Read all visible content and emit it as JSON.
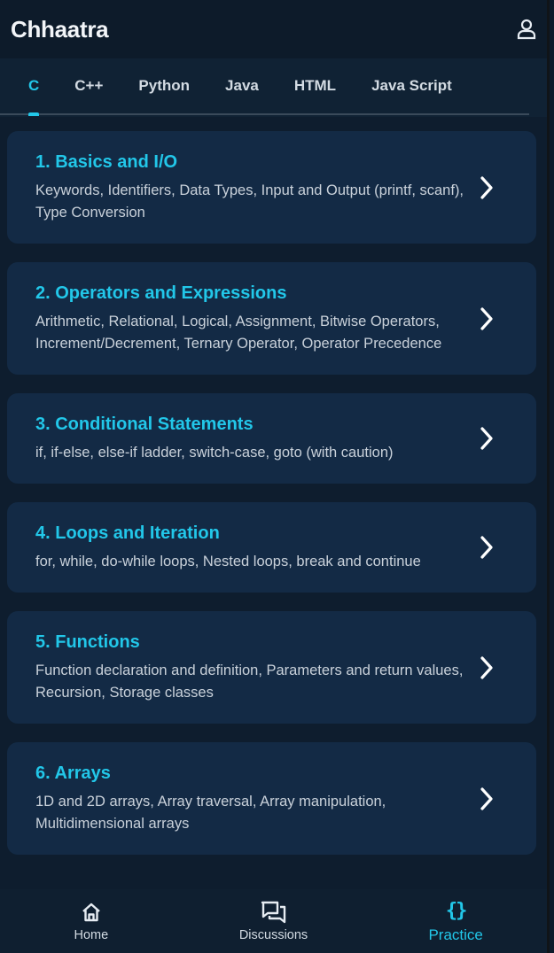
{
  "app": {
    "title": "Chhaatra"
  },
  "tabs": [
    {
      "label": "C",
      "active": true
    },
    {
      "label": "C++"
    },
    {
      "label": "Python"
    },
    {
      "label": "Java"
    },
    {
      "label": "HTML"
    },
    {
      "label": "Java Script"
    }
  ],
  "topics": [
    {
      "title": "1. Basics and I/O",
      "desc": "Keywords, Identifiers, Data Types, Input and Output (printf, scanf), Type Conversion"
    },
    {
      "title": "2. Operators and Expressions",
      "desc": "Arithmetic, Relational, Logical, Assignment, Bitwise Operators, Increment/Decrement, Ternary Operator, Operator Precedence"
    },
    {
      "title": "3. Conditional Statements",
      "desc": "if, if-else, else-if ladder, switch-case, goto (with caution)"
    },
    {
      "title": "4. Loops and Iteration",
      "desc": "for, while, do-while loops, Nested loops, break and continue"
    },
    {
      "title": "5. Functions",
      "desc": "Function declaration and definition, Parameters and return values, Recursion, Storage classes"
    },
    {
      "title": "6. Arrays",
      "desc": "1D and 2D arrays, Array traversal, Array manipulation, Multidimensional arrays"
    }
  ],
  "bottom_nav": {
    "home": {
      "label": "Home",
      "icon": "home-icon"
    },
    "discussions": {
      "label": "Discussions",
      "icon": "chat-icon"
    },
    "practice": {
      "label": "Practice",
      "icon": "code-braces-icon",
      "glyph": "{}"
    }
  },
  "colors": {
    "accent": "#22c7e9",
    "background": "#0e1d2e",
    "card": "#132a45"
  }
}
